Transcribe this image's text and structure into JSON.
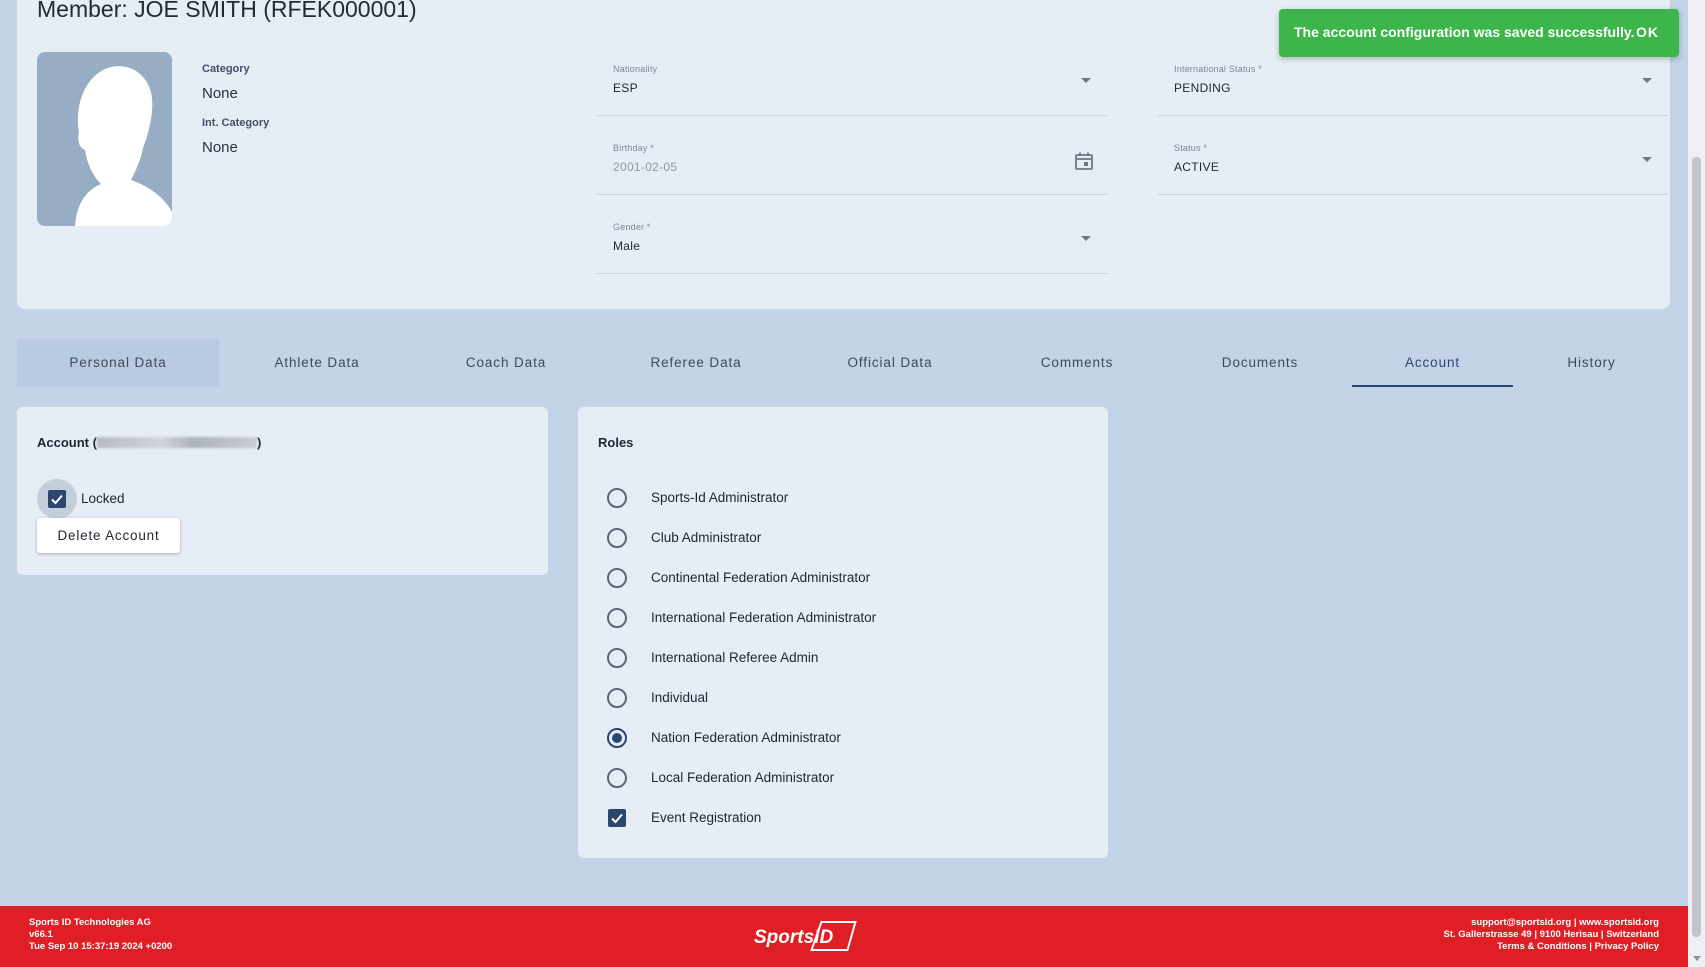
{
  "member": {
    "title": "Member: JOE SMITH (RFEK000001)",
    "category_label": "Category",
    "category_value": "None",
    "int_category_label": "Int. Category",
    "int_category_value": "None",
    "fields": {
      "nationality": {
        "label": "Nationality",
        "value": "ESP"
      },
      "international_status": {
        "label": "International Status *",
        "value": "PENDING"
      },
      "birthday": {
        "label": "Birthday *",
        "value": "2001-02-05"
      },
      "status": {
        "label": "Status *",
        "value": "ACTIVE"
      },
      "gender": {
        "label": "Gender *",
        "value": "Male"
      }
    }
  },
  "tabs": [
    {
      "label": "Personal Data",
      "state": "hovered"
    },
    {
      "label": "Athlete Data",
      "state": "normal"
    },
    {
      "label": "Coach Data",
      "state": "normal"
    },
    {
      "label": "Referee Data",
      "state": "normal"
    },
    {
      "label": "Official Data",
      "state": "normal"
    },
    {
      "label": "Comments",
      "state": "normal"
    },
    {
      "label": "Documents",
      "state": "normal"
    },
    {
      "label": "Account",
      "state": "active"
    },
    {
      "label": "History",
      "state": "normal"
    }
  ],
  "account": {
    "title_prefix": "Account (",
    "title_suffix": ")",
    "locked_label": "Locked",
    "locked_checked": true,
    "delete_button": "Delete Account"
  },
  "roles": {
    "title": "Roles",
    "items": [
      {
        "label": "Sports-Id Administrator",
        "control": "radio",
        "checked": false
      },
      {
        "label": "Club Administrator",
        "control": "radio",
        "checked": false
      },
      {
        "label": "Continental Federation Administrator",
        "control": "radio",
        "checked": false
      },
      {
        "label": "International Federation Administrator",
        "control": "radio",
        "checked": false
      },
      {
        "label": "International Referee Admin",
        "control": "radio",
        "checked": false
      },
      {
        "label": "Individual",
        "control": "radio",
        "checked": false
      },
      {
        "label": "Nation Federation Administrator",
        "control": "radio",
        "checked": true
      },
      {
        "label": "Local Federation Administrator",
        "control": "radio",
        "checked": false
      },
      {
        "label": "Event Registration",
        "control": "checkbox",
        "checked": true
      }
    ]
  },
  "toast": {
    "message": "The account configuration was saved successfully.",
    "action": "OK"
  },
  "footer": {
    "company": "Sports ID Technologies AG",
    "version": "v66.1",
    "timestamp": "Tue Sep 10 15:37:19 2024 +0200",
    "logo_text": "SportsID",
    "contact": "support@sportsid.org | www.sportsid.org",
    "address": "St. Gallerstrasse 49 | 9100 Herisau | Switzerland",
    "links": "Terms & Conditions | Privacy Policy"
  },
  "colors": {
    "background": "#c3d3e8",
    "card": "#e7edf5",
    "accent": "#2c466e",
    "toast": "#3cb54a",
    "footer": "#e01e25"
  }
}
